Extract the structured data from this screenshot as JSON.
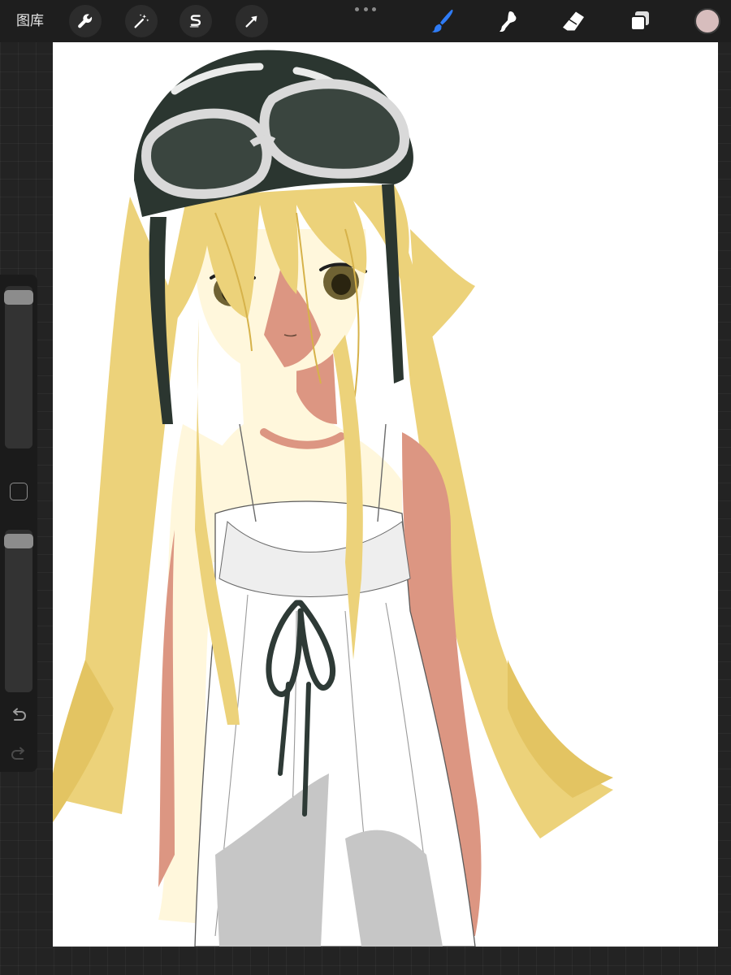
{
  "toolbar": {
    "gallery_label": "图库",
    "actions": [
      {
        "icon": "wrench-icon",
        "name": "actions-button"
      },
      {
        "icon": "magic-wand-icon",
        "name": "adjustments-button"
      },
      {
        "icon": "selection-s-icon",
        "name": "selection-button"
      },
      {
        "icon": "arrow-cursor-icon",
        "name": "transform-button"
      }
    ],
    "tools": [
      {
        "icon": "brush-icon",
        "name": "brush-tool",
        "active": true
      },
      {
        "icon": "smudge-icon",
        "name": "smudge-tool",
        "active": false
      },
      {
        "icon": "eraser-icon",
        "name": "eraser-tool",
        "active": false
      },
      {
        "icon": "layers-icon",
        "name": "layers-button",
        "active": false
      }
    ],
    "current_color": "#d7bdbd",
    "accent_color": "#2f7cf6"
  },
  "sidebar": {
    "brush_size_level": 0.97,
    "opacity_level": 0.97,
    "modify_button_icon": "square-icon",
    "undo_icon": "undo-icon",
    "redo_icon": "redo-icon"
  },
  "canvas": {
    "background": "#ffffff",
    "artwork": "girl-with-goggles-illustration"
  }
}
